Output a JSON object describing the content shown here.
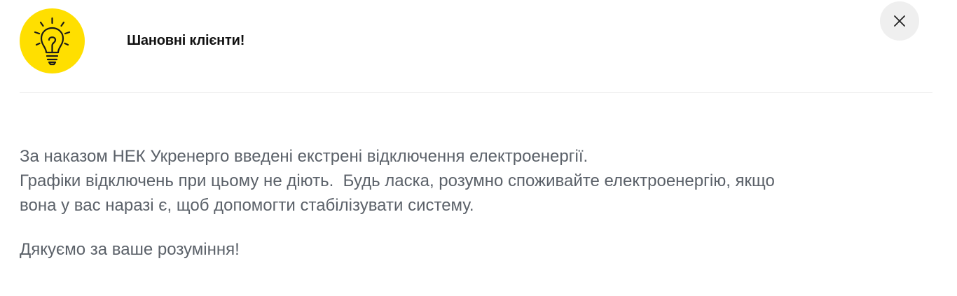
{
  "header": {
    "icon": "lightbulb-icon",
    "title": "Шановні клієнти!",
    "close_icon": "close-icon"
  },
  "message": {
    "line1": "За наказом НЕК Укренерго введені екстрені відключення електроенергії.",
    "line2": "Графіки відключень при цьому не діють.  Будь ласка, розумно споживайте електроенергію, якщо",
    "line3": "вона у вас наразі є, щоб допомогти стабілізувати систему.",
    "closing": "Дякуємо за ваше розуміння!"
  },
  "colors": {
    "accent": "#ffdf00",
    "text": "#5b6169",
    "title": "#111111",
    "close_bg": "#efefef"
  }
}
